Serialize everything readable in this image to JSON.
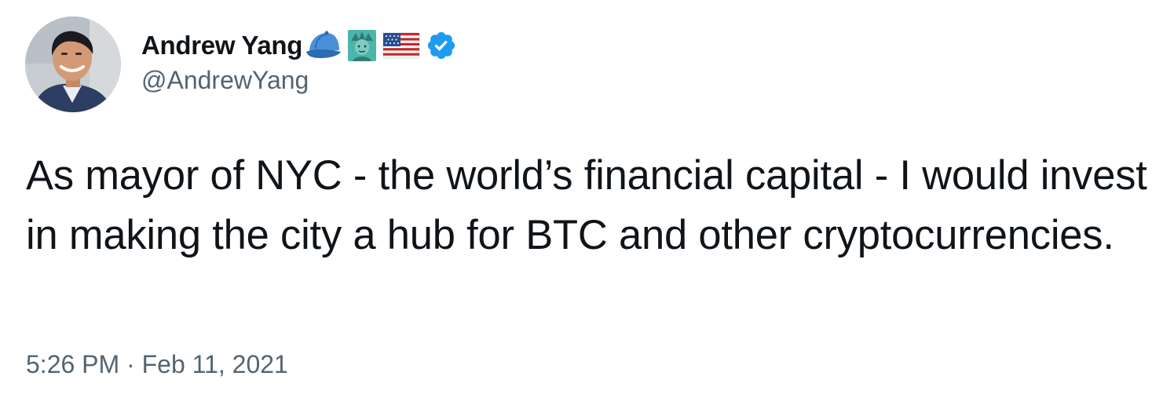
{
  "tweet": {
    "author": {
      "display_name": "Andrew Yang",
      "handle": "@AndrewYang",
      "name_emojis": [
        "blue-cap-icon",
        "statue-of-liberty-icon",
        "us-flag-icon"
      ],
      "verified": true,
      "verified_badge_icon": "verified-badge-icon",
      "avatar_icon": "avatar-photo"
    },
    "text": "As mayor of NYC - the world’s financial capital - I would invest in making the city a hub for BTC and other cryptocurrencies.",
    "time": "5:26 PM",
    "separator": " · ",
    "date": "Feb 11, 2021"
  },
  "colors": {
    "text_primary": "#0f1419",
    "text_secondary": "#536471",
    "verified_blue": "#1d9bf0"
  }
}
